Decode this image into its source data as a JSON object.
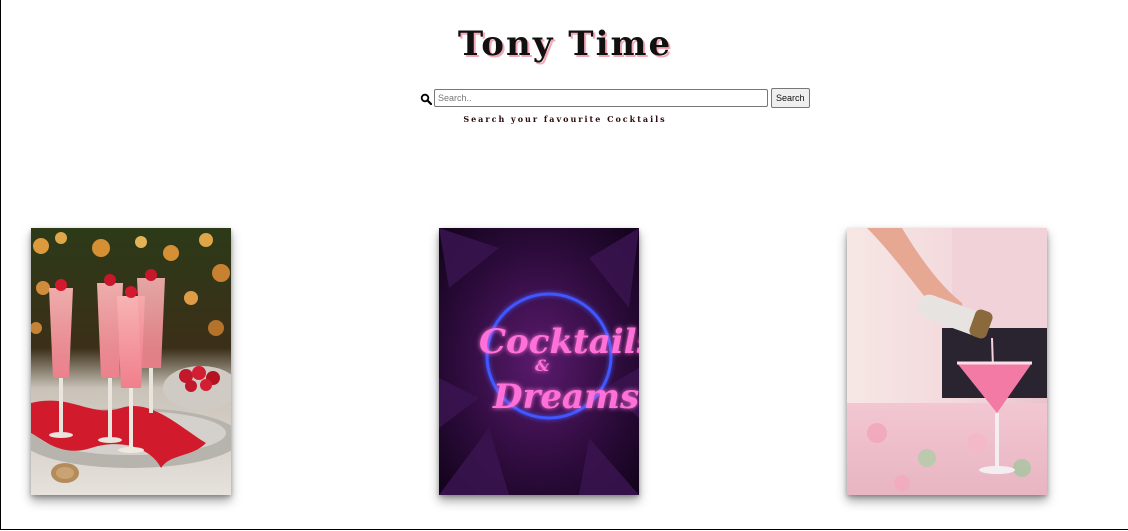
{
  "header": {
    "title": "Tony Time",
    "tagline": "Search your favourite Cocktails"
  },
  "search": {
    "icon": "search-icon",
    "placeholder": "Search..",
    "value": "",
    "button_label": "Search"
  },
  "gallery": {
    "items": [
      {
        "name": "champagne-raspberry-cocktails-photo"
      },
      {
        "name": "neon-sign-photo",
        "sign_text": "Cocktails & Dreams"
      },
      {
        "name": "pink-martini-pour-photo"
      }
    ]
  }
}
